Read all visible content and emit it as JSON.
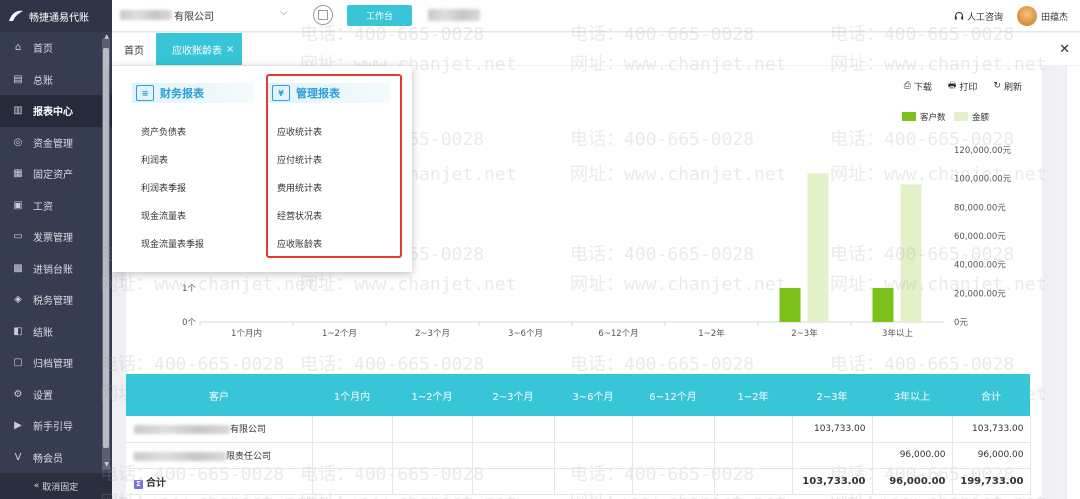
{
  "brand": {
    "name": "畅捷通易代账"
  },
  "header": {
    "company_suffix": "有限公司",
    "workbench_label": "工作台",
    "service_label": "人工咨询",
    "user_name": "田蕴杰"
  },
  "sidebar": {
    "items": [
      {
        "label": "首页",
        "icon": "home-icon"
      },
      {
        "label": "总账",
        "icon": "ledger-icon"
      },
      {
        "label": "报表中心",
        "icon": "chart-icon",
        "active": true
      },
      {
        "label": "资金管理",
        "icon": "money-icon"
      },
      {
        "label": "固定资产",
        "icon": "asset-icon"
      },
      {
        "label": "工资",
        "icon": "salary-icon"
      },
      {
        "label": "发票管理",
        "icon": "invoice-icon"
      },
      {
        "label": "进销台账",
        "icon": "inventory-icon"
      },
      {
        "label": "税务管理",
        "icon": "tax-icon"
      },
      {
        "label": "结账",
        "icon": "close-period-icon"
      },
      {
        "label": "归档管理",
        "icon": "archive-icon"
      },
      {
        "label": "设置",
        "icon": "gear-icon"
      },
      {
        "label": "新手引导",
        "icon": "guide-icon"
      },
      {
        "label": "畅会员",
        "icon": "vip-icon"
      }
    ],
    "unfix_label": "取消固定"
  },
  "tabs": [
    {
      "label": "首页"
    },
    {
      "label": "应收账龄表",
      "active": true
    }
  ],
  "toolbar": {
    "download": "下载",
    "print": "打印",
    "refresh": "刷新"
  },
  "menu": {
    "finance": {
      "title": "财务报表",
      "items": [
        "资产负债表",
        "利润表",
        "利润表季报",
        "现金流量表",
        "现金流量表季报"
      ]
    },
    "management": {
      "title": "管理报表",
      "items": [
        "应收统计表",
        "应付统计表",
        "费用统计表",
        "经营状况表",
        "应收账龄表"
      ]
    }
  },
  "chart_data": {
    "type": "bar",
    "categories": [
      "1个月内",
      "1~2个月",
      "2~3个月",
      "3~6个月",
      "6~12个月",
      "1~2年",
      "2~3年",
      "3年以上"
    ],
    "series": [
      {
        "name": "客户数",
        "axis": "left",
        "color": "#7cc21b",
        "values": [
          0,
          0,
          0,
          0,
          0,
          0,
          1,
          1
        ]
      },
      {
        "name": "金额",
        "axis": "right",
        "color": "#e3f1c9",
        "values": [
          0,
          0,
          0,
          0,
          0,
          0,
          103733,
          96000
        ]
      }
    ],
    "y_left_ticks_visible": [
      "0个",
      "1个"
    ],
    "y_right_ticks": [
      "0元",
      "20,000.00元",
      "40,000.00元",
      "60,000.00元",
      "80,000.00元",
      "100,000.00元",
      "120,000.00元"
    ],
    "y_right_range": [
      0,
      120000
    ],
    "legend_position": "top-right"
  },
  "table": {
    "headers": [
      "客户",
      "1个月内",
      "1~2个月",
      "2~3个月",
      "3~6个月",
      "6~12个月",
      "1~2年",
      "2~3年",
      "3年以上",
      "合计"
    ],
    "rows": [
      {
        "customer_suffix": "有限公司",
        "values": [
          "",
          "",
          "",
          "",
          "",
          "",
          "103,733.00",
          "",
          "103,733.00"
        ]
      },
      {
        "customer_suffix": "限责任公司",
        "values": [
          "",
          "",
          "",
          "",
          "",
          "",
          "",
          "96,000.00",
          "96,000.00"
        ]
      }
    ],
    "total": {
      "label": "合计",
      "values": [
        "",
        "",
        "",
        "",
        "",
        "",
        "103,733.00",
        "96,000.00",
        "199,733.00"
      ]
    }
  },
  "watermark": {
    "phone": "电话：400-665-0028",
    "site": "网址：www.chanjet.net"
  }
}
